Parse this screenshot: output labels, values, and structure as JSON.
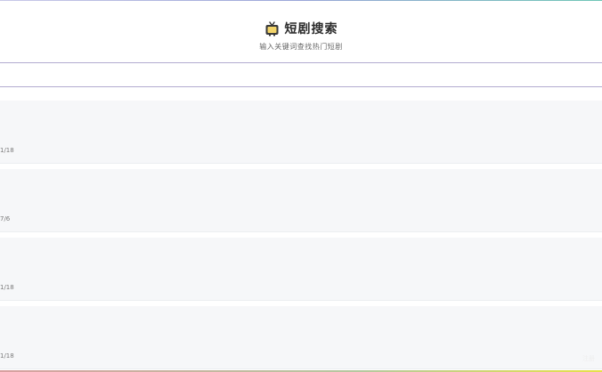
{
  "header": {
    "title": "短剧搜索",
    "subtitle": "输入关键词查找热门短剧",
    "icon": "tv-icon"
  },
  "search": {
    "placeholder": "",
    "value": ""
  },
  "results": [
    {
      "date": "1/18"
    },
    {
      "date": "7/6"
    },
    {
      "date": "1/18"
    },
    {
      "date": "1/18"
    }
  ],
  "footer": {
    "mark": "注册"
  },
  "colors": {
    "card_bg": "#f6f7f9",
    "search_border": "#b3abd0",
    "title": "#2b2b2b"
  }
}
